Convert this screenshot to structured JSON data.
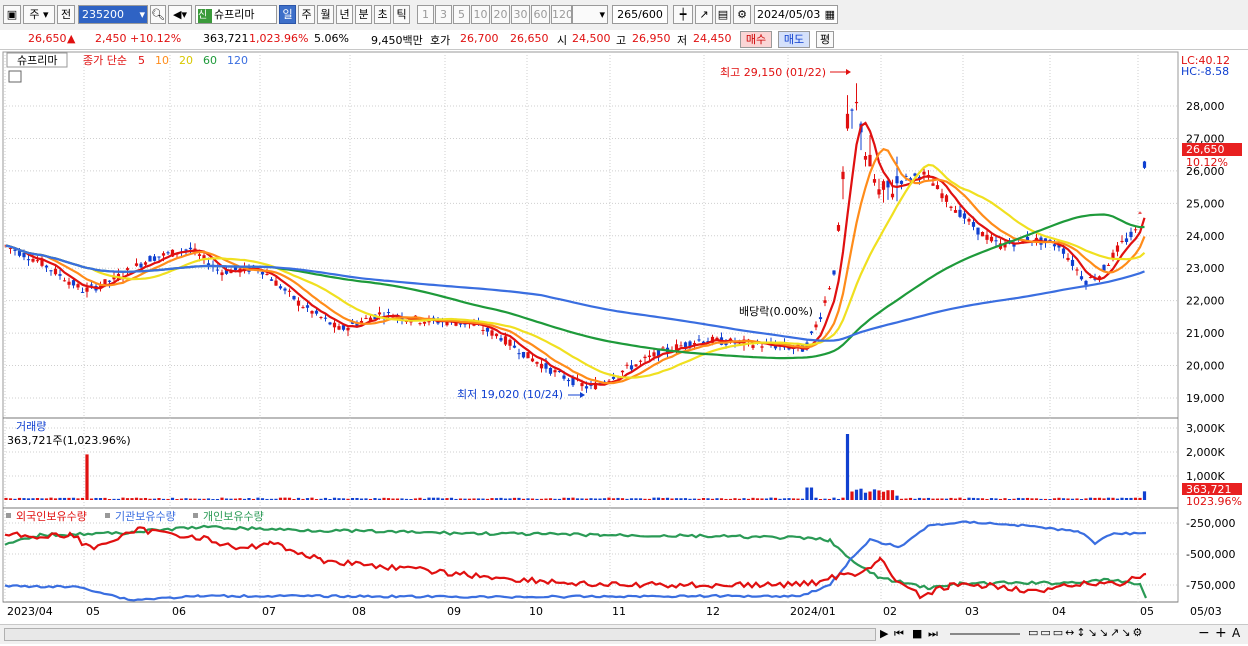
{
  "toolbar": {
    "market_type": "주",
    "compare": "전",
    "code": "235200",
    "badge": "신",
    "stock_name": "슈프리마",
    "periods": [
      "일",
      "주",
      "월",
      "년",
      "분",
      "초",
      "틱"
    ],
    "selected_period": "일",
    "intervals": [
      "1",
      "3",
      "5",
      "10",
      "20",
      "30",
      "60",
      "120"
    ],
    "count": "265",
    "count_max": "/600",
    "date": "2024/05/03"
  },
  "info": {
    "price": "26,650",
    "change_symbol": "▲",
    "change": "2,450",
    "change_pct": "+10.12%",
    "volume": "363,721",
    "volume_pct": "1,023.96%",
    "turnover_pct": "5.06%",
    "amount": "9,450백만",
    "quote_label": "호가",
    "ask": "26,700",
    "bid": "26,650",
    "open_label": "시",
    "open": "24,500",
    "high_label": "고",
    "high": "26,950",
    "low_label": "저",
    "low": "24,450",
    "buy_label": "매수",
    "sell_label": "매도",
    "avg_label": "평"
  },
  "price_panel": {
    "stock_label": "슈프리마",
    "ma_label": "종가 단순",
    "ma_periods": [
      "5",
      "10",
      "20",
      "60",
      "120"
    ],
    "lc": "LC:40.12",
    "hc": "HC:-8.58",
    "y_ticks": [
      "28,000",
      "27,000",
      "26,000",
      "25,000",
      "24,000",
      "23,000",
      "22,000",
      "21,000",
      "20,000",
      "19,000"
    ],
    "current_price": "26,650",
    "current_pct": "10.12%",
    "high_annotation": "최고 29,150 (01/22)",
    "low_annotation": "최저 19,020 (10/24)",
    "dividend_label": "배당락(0.00%)"
  },
  "volume_panel": {
    "title": "거래량",
    "value": "363,721주(1,023.96%)",
    "y_ticks": [
      "3,000K",
      "2,000K",
      "1,000K"
    ],
    "current_volume": "363,721",
    "current_pct": "1023.96%"
  },
  "holdings_panel": {
    "series": [
      "외국인보유수량",
      "기관보유수량",
      "개인보유수량"
    ],
    "y_ticks": [
      "-250,000",
      "-500,000",
      "-750,000"
    ]
  },
  "x_axis": {
    "labels": [
      "2023/04",
      "05",
      "06",
      "07",
      "08",
      "09",
      "10",
      "11",
      "12",
      "2024/01",
      "02",
      "03",
      "04",
      "05",
      "05/03"
    ]
  },
  "colors": {
    "up": "#e01010",
    "down": "#1040d0",
    "ma5": "#e01010",
    "ma10": "#ff8c1a",
    "ma20": "#f0e020",
    "ma60": "#1e9a3a",
    "ma120": "#3a6ee0"
  }
}
